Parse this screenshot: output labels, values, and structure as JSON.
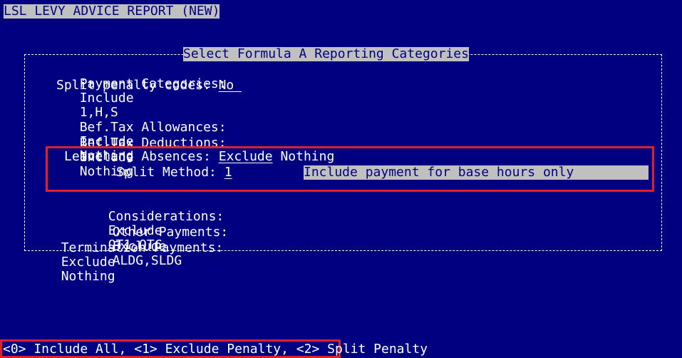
{
  "screen_title": "LSL LEVY ADVICE REPORT (NEW)",
  "panel_title": "Select Formula A Reporting Categories",
  "rows": {
    "payment_categories": {
      "label": "Payment Categories:",
      "mode": "Include",
      "value": "1,H,S"
    },
    "split_penalty": {
      "label": "Split penalty codes:",
      "value": "No"
    },
    "bef_tax_allowances": {
      "label": "Bef.Tax Allowances:",
      "mode": "Include",
      "value": "Nothing"
    },
    "bef_tax_deductions": {
      "label": "Bef.Tax Deductions:",
      "mode": "Include",
      "value": "Nothing"
    },
    "leave_absences": {
      "label": "Leave and Absences:",
      "mode": "Exclude",
      "value": "Nothing"
    },
    "split_method": {
      "label": "Split Method:",
      "value": "1",
      "description": "Include payment for base hours only"
    },
    "considerations": {
      "label": "Considerations:",
      "mode": "Exclude",
      "value": "OT1,OTC"
    },
    "other_payments": {
      "label": "Other Payments:",
      "mode": "Exclude",
      "value": "ALDG,SLDG"
    },
    "termination_payments": {
      "label": "Termination Payments:",
      "mode": "Exclude",
      "value": "Nothing"
    }
  },
  "status_line": "<0> Include All, <1> Exclude Penalty, <2> Split Penalty"
}
